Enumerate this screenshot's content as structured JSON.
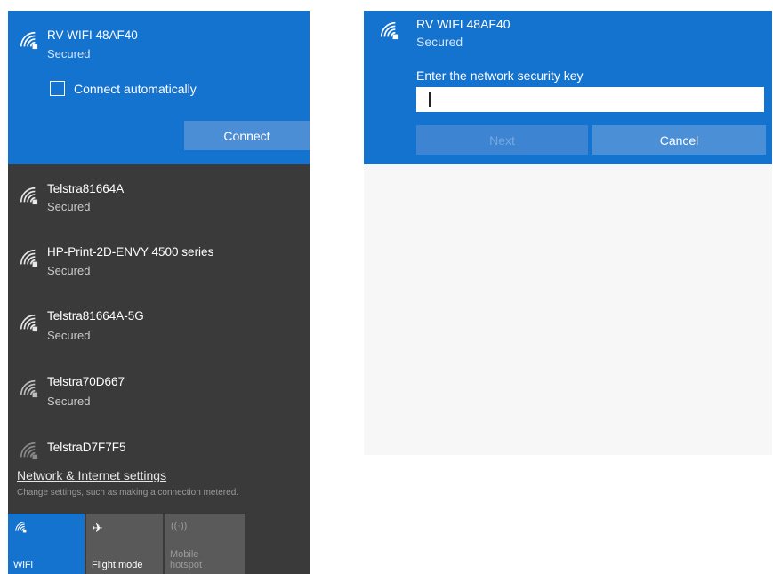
{
  "left_panel": {
    "selected_network": {
      "name": "RV WIFI 48AF40",
      "status": "Secured",
      "connect_auto_label": "Connect automatically",
      "connect_auto_checked": false,
      "connect_button_label": "Connect"
    },
    "networks": [
      {
        "name": "Telstra81664A",
        "status": "Secured"
      },
      {
        "name": "HP-Print-2D-ENVY 4500 series",
        "status": "Secured"
      },
      {
        "name": "Telstra81664A-5G",
        "status": "Secured"
      },
      {
        "name": "Telstra70D667",
        "status": "Secured"
      },
      {
        "name": "TelstraD7F7F5",
        "status": ""
      }
    ],
    "settings_link": "Network & Internet settings",
    "settings_sub": "Change settings, such as making a connection metered.",
    "tiles": [
      {
        "label": "WiFi",
        "icon": "wifi-icon"
      },
      {
        "label": "Flight mode",
        "icon": "airplane-icon"
      },
      {
        "label": "Mobile hotspot",
        "icon": "hotspot-icon"
      }
    ]
  },
  "dialog": {
    "network_name": "RV WIFI 48AF40",
    "status": "Secured",
    "prompt": "Enter the network security key",
    "input_value": "",
    "next_label": "Next",
    "cancel_label": "Cancel"
  },
  "colors": {
    "accent": "#1473cf",
    "panel_dark": "#3a3a3b"
  }
}
